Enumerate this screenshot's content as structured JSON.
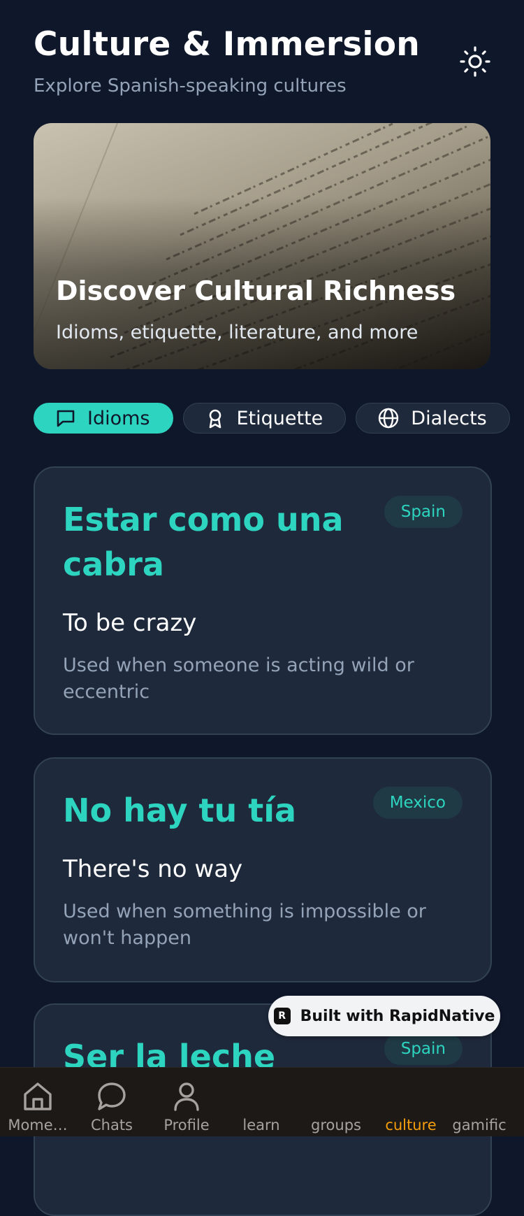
{
  "header": {
    "title": "Culture & Immersion",
    "subtitle": "Explore Spanish-speaking cultures"
  },
  "hero": {
    "title": "Discover Cultural Richness",
    "subtitle": "Idioms, etiquette, literature, and more"
  },
  "tabs": [
    {
      "label": "Idioms",
      "icon": "chat-icon",
      "active": true
    },
    {
      "label": "Etiquette",
      "icon": "award-icon",
      "active": false
    },
    {
      "label": "Dialects",
      "icon": "globe-icon",
      "active": false
    }
  ],
  "idioms": [
    {
      "phrase": "Estar como una cabra",
      "region": "Spain",
      "meaning": "To be crazy",
      "usage": "Used when someone is acting wild or eccentric"
    },
    {
      "phrase": "No hay tu tía",
      "region": "Mexico",
      "meaning": "There's no way",
      "usage": "Used when something is impossible or won't happen"
    },
    {
      "phrase": "Ser la leche",
      "region": "Spain"
    }
  ],
  "built_with": "Built with RapidNative",
  "nav": [
    {
      "label": "Mome…",
      "icon": "home-icon"
    },
    {
      "label": "Chats",
      "icon": "chat-bubble-icon"
    },
    {
      "label": "Profile",
      "icon": "user-icon"
    },
    {
      "label": "learn"
    },
    {
      "label": "groups"
    },
    {
      "label": "culture",
      "active": true
    },
    {
      "label": "gamific"
    }
  ],
  "colors": {
    "accent": "#2dd4bf",
    "background": "#0f172a",
    "card": "#1e293b",
    "nav_active": "#f59e0b"
  }
}
